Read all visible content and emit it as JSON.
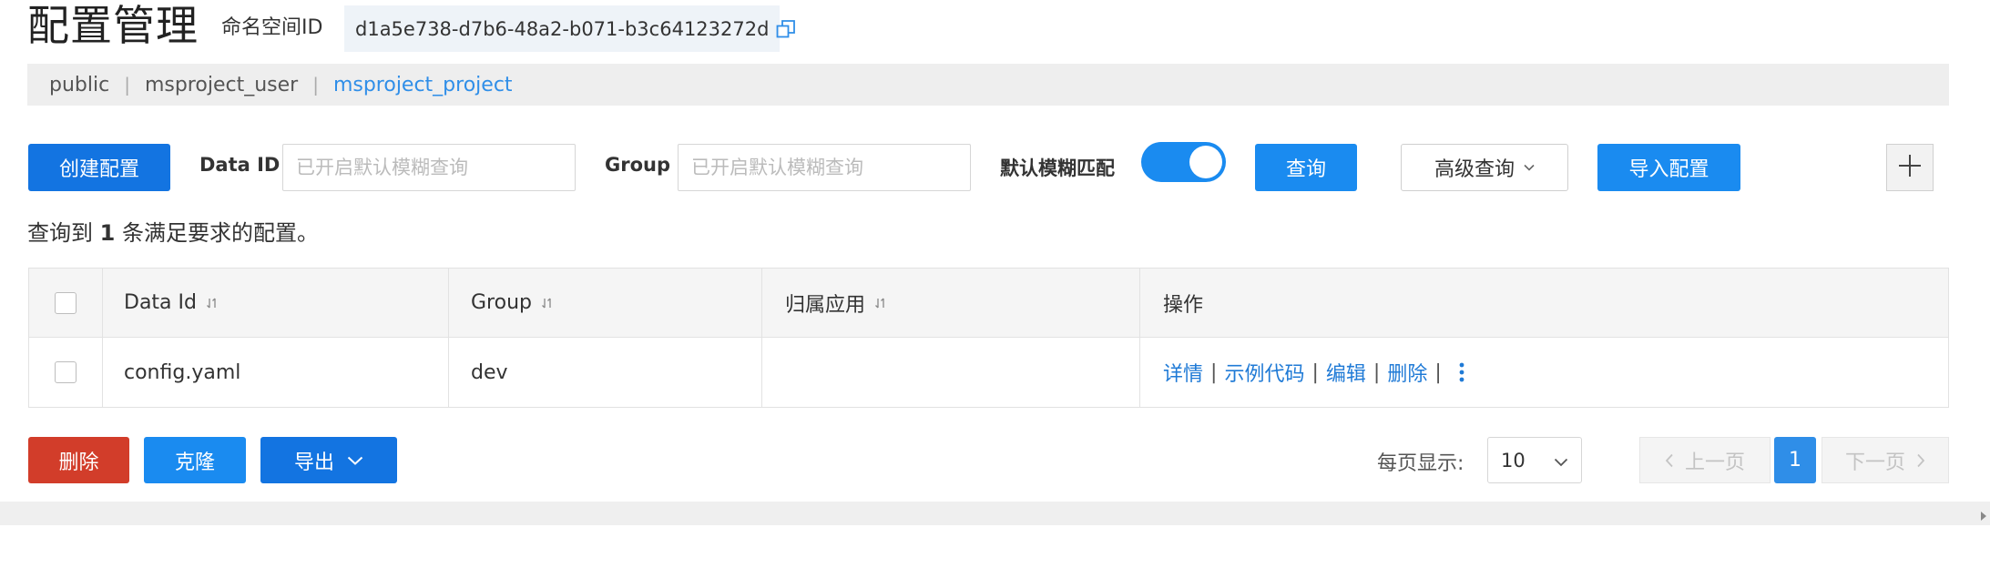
{
  "page": {
    "title": "配置管理",
    "namespace_label": "命名空间ID",
    "namespace_id": "d1a5e738-d7b6-48a2-b071-b3c64123272d"
  },
  "namespaces": [
    {
      "label": "public",
      "active": false
    },
    {
      "label": "msproject_user",
      "active": false
    },
    {
      "label": "msproject_project",
      "active": true
    }
  ],
  "namespace_separator": "|",
  "toolbar": {
    "create_label": "创建配置",
    "dataid_label": "Data ID",
    "dataid_placeholder": "已开启默认模糊查询",
    "group_label": "Group",
    "group_placeholder": "已开启默认模糊查询",
    "fuzzy_label": "默认模糊匹配",
    "fuzzy_enabled": true,
    "search_label": "查询",
    "advanced_label": "高级查询",
    "import_label": "导入配置",
    "plus_icon": "plus-icon"
  },
  "summary": {
    "prefix": "查询到",
    "count": "1",
    "suffix": "条满足要求的配置。"
  },
  "table": {
    "headers": {
      "data_id": "Data Id",
      "group": "Group",
      "app": "归属应用",
      "ops": "操作"
    },
    "rows": [
      {
        "data_id": "config.yaml",
        "group": "dev",
        "app": "",
        "ops": {
          "detail": "详情",
          "sample_code": "示例代码",
          "edit": "编辑",
          "delete": "删除",
          "sep": "|"
        }
      }
    ]
  },
  "bottom": {
    "delete_label": "删除",
    "clone_label": "克隆",
    "export_label": "导出",
    "pagesize_label": "每页显示:",
    "pagesize_value": "10",
    "prev_label": "上一页",
    "current_page": "1",
    "next_label": "下一页"
  },
  "colors": {
    "primary": "#1a8bf0",
    "primary_dark": "#1374e1",
    "danger": "#d23d2a",
    "link": "#1f7ad6"
  }
}
